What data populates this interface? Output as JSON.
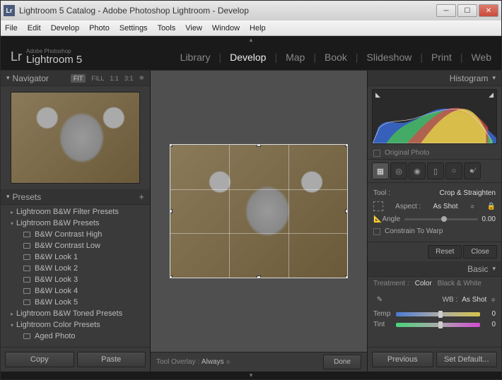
{
  "window": {
    "title": "Lightroom 5 Catalog - Adobe Photoshop Lightroom - Develop"
  },
  "menu": [
    "File",
    "Edit",
    "Develop",
    "Photo",
    "Settings",
    "Tools",
    "View",
    "Window",
    "Help"
  ],
  "brand": {
    "sub": "Adobe Photoshop",
    "main": "Lightroom 5"
  },
  "modules": [
    "Library",
    "Develop",
    "Map",
    "Book",
    "Slideshow",
    "Print",
    "Web"
  ],
  "active_module": "Develop",
  "navigator": {
    "title": "Navigator",
    "opts": [
      "FIT",
      "FILL",
      "1:1",
      "3:1"
    ],
    "selected": "FIT"
  },
  "presets": {
    "title": "Presets",
    "groups": [
      {
        "name": "Lightroom B&W Filter Presets",
        "open": false
      },
      {
        "name": "Lightroom B&W Presets",
        "open": true,
        "items": [
          "B&W Contrast High",
          "B&W Contrast Low",
          "B&W Look 1",
          "B&W Look 2",
          "B&W Look 3",
          "B&W Look 4",
          "B&W Look 5"
        ]
      },
      {
        "name": "Lightroom B&W Toned Presets",
        "open": false
      },
      {
        "name": "Lightroom Color Presets",
        "open": true,
        "items": [
          "Aged Photo"
        ]
      }
    ]
  },
  "left_buttons": {
    "copy": "Copy",
    "paste": "Paste"
  },
  "histogram": {
    "title": "Histogram",
    "original": "Original Photo"
  },
  "crop_tool": {
    "label": "Tool :",
    "name": "Crop & Straighten",
    "aspect_label": "Aspect :",
    "aspect_value": "As Shot",
    "angle_label": "Angle",
    "angle_value": "0.00",
    "constrain": "Constrain To Warp",
    "reset": "Reset",
    "close": "Close"
  },
  "basic": {
    "title": "Basic",
    "treatment_label": "Treatment :",
    "treatment_color": "Color",
    "treatment_bw": "Black & White",
    "wb_label": "WB :",
    "wb_value": "As Shot",
    "temp_label": "Temp",
    "temp_value": "0",
    "tint_label": "Tint",
    "tint_value": "0"
  },
  "right_buttons": {
    "previous": "Previous",
    "setdefault": "Set Default..."
  },
  "center": {
    "overlay_label": "Tool Overlay :",
    "overlay_value": "Always",
    "done": "Done"
  }
}
